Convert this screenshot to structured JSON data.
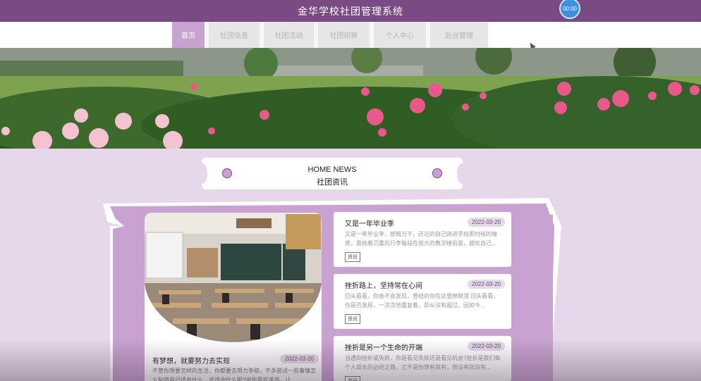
{
  "header": {
    "title": "金华学校社团管理系统",
    "timer": "00:00"
  },
  "nav": {
    "items": [
      {
        "label": "首页",
        "active": true
      },
      {
        "label": "社团信息",
        "active": false
      },
      {
        "label": "社团活动",
        "active": false
      },
      {
        "label": "社团招新",
        "active": false
      },
      {
        "label": "个人中心",
        "active": false
      },
      {
        "label": "后台管理",
        "active": false
      }
    ]
  },
  "section": {
    "title_en": "HOME NEWS",
    "title_cn": "社团资讯"
  },
  "featured": {
    "title": "有梦想，就要努力去实现",
    "date": "2022-03-20",
    "desc": "不管你想要怎样的生活，你都要去努力争取，不多尝试一些事情怎么知道自己适合什么，不适合什么呢?说你喜欢读书，让"
  },
  "news": [
    {
      "title": "又是一年毕业季",
      "date": "2022-03-20",
      "desc": "又是一年毕业季，感慨万千，还记的自己刚进学校那时候的情景，我拖着沉重的行李箱站在偌大的教学楼前面，感叹自己...",
      "tag": "资讯"
    },
    {
      "title": "挫折路上，坚持常在心间",
      "date": "2022-03-20",
      "desc": "回头看看，你会不会发现，曾经的你在这里掉眼泪 回头看看，你是否发现，一次次地重复着，却从没有超过，因如今...",
      "tag": "资讯"
    },
    {
      "title": "挫折是另一个生命的开端",
      "date": "2022-03-20",
      "desc": "当遇到挫折或失败，你是看见失败还是看见机会?挫折是我们每个人成长的必经之路，它不是你想有就有，想没有就没有...",
      "tag": "资讯"
    }
  ],
  "colors": {
    "primary": "#7a4a85",
    "accent": "#c8a3d1",
    "background": "#e6d8ea"
  }
}
